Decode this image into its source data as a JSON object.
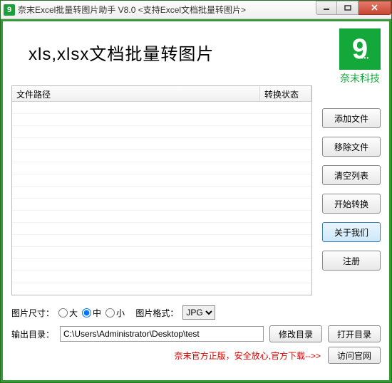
{
  "titlebar": {
    "icon_letter": "9",
    "text": "奈末Excel批量转图片助手 V8.0   <支持Excel文档批量转图片>"
  },
  "heading": "xls,xlsx文档批量转图片",
  "logo": {
    "letter": "9",
    "brand": "奈末科技"
  },
  "table": {
    "col_path": "文件路径",
    "col_status": "转换状态"
  },
  "buttons": {
    "add": "添加文件",
    "remove": "移除文件",
    "clear": "清空列表",
    "start": "开始转换",
    "about": "关于我们",
    "register": "注册",
    "modify_dir": "修改目录",
    "open_dir": "打开目录",
    "visit_site": "访问官网"
  },
  "options": {
    "size_label": "图片尺寸：",
    "size_large": "大",
    "size_medium": "中",
    "size_small": "小",
    "format_label": "图片格式：",
    "format_value": "JPG"
  },
  "output": {
    "label": "输出目录：",
    "path": "C:\\Users\\Administrator\\Desktop\\test"
  },
  "footer": {
    "text": "奈末官方正版，安全放心,官方下载-->>"
  }
}
